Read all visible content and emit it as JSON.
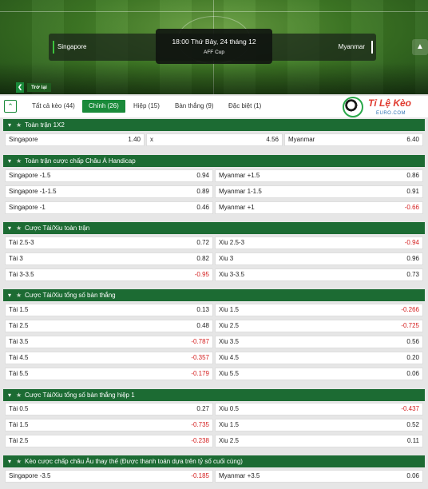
{
  "match": {
    "home": "Singapore",
    "away": "Myanmar",
    "time": "18:00 Thứ Bảy, 24 tháng 12",
    "league": "AFF Cup",
    "back_label": "Trở lại"
  },
  "tabs": [
    {
      "label": "Tất cả kèo (44)",
      "active": false
    },
    {
      "label": "Chính (26)",
      "active": true
    },
    {
      "label": "Hiệp (15)",
      "active": false
    },
    {
      "label": "Bàn thắng (9)",
      "active": false
    },
    {
      "label": "Đặc biệt (1)",
      "active": false
    }
  ],
  "logo": {
    "brand": "Tỉ Lệ Kèo",
    "sub": "EURO.COM"
  },
  "colors": {
    "accent": "#1a8a3a",
    "section": "#1c6b33",
    "negative": "#d42020"
  },
  "sections": {
    "s1": {
      "title": "Toàn trận 1X2",
      "cells": [
        {
          "label": "Singapore",
          "value": "1.40"
        },
        {
          "label": "x",
          "value": "4.56"
        },
        {
          "label": "Myanmar",
          "value": "6.40"
        }
      ]
    },
    "s2": {
      "title": "Toàn trận cược chấp Châu Á Handicap",
      "rows": [
        [
          {
            "label": "Singapore -1.5",
            "value": "0.94"
          },
          {
            "label": "Myanmar +1.5",
            "value": "0.86"
          }
        ],
        [
          {
            "label": "Singapore -1-1.5",
            "value": "0.89"
          },
          {
            "label": "Myanmar 1-1.5",
            "value": "0.91"
          }
        ],
        [
          {
            "label": "Singapore -1",
            "value": "0.46"
          },
          {
            "label": "Myanmar +1",
            "value": "-0.66"
          }
        ]
      ]
    },
    "s3": {
      "title": "Cược Tài/Xiu toàn trận",
      "rows": [
        [
          {
            "label": "Tài 2.5-3",
            "value": "0.72"
          },
          {
            "label": "Xiu 2.5-3",
            "value": "-0.94"
          }
        ],
        [
          {
            "label": "Tài 3",
            "value": "0.82"
          },
          {
            "label": "Xiu 3",
            "value": "0.96"
          }
        ],
        [
          {
            "label": "Tài 3-3.5",
            "value": "-0.95"
          },
          {
            "label": "Xiu 3-3.5",
            "value": "0.73"
          }
        ]
      ]
    },
    "s4": {
      "title": "Cược Tài/Xiu tổng số bàn thắng",
      "rows": [
        [
          {
            "label": "Tài 1.5",
            "value": "0.13"
          },
          {
            "label": "Xiu 1.5",
            "value": "-0.266"
          }
        ],
        [
          {
            "label": "Tài 2.5",
            "value": "0.48"
          },
          {
            "label": "Xiu 2.5",
            "value": "-0.725"
          }
        ],
        [
          {
            "label": "Tài 3.5",
            "value": "-0.787"
          },
          {
            "label": "Xiu 3.5",
            "value": "0.56"
          }
        ],
        [
          {
            "label": "Tài 4.5",
            "value": "-0.357"
          },
          {
            "label": "Xiu 4.5",
            "value": "0.20"
          }
        ],
        [
          {
            "label": "Tài 5.5",
            "value": "-0.179"
          },
          {
            "label": "Xiu 5.5",
            "value": "0.06"
          }
        ]
      ]
    },
    "s5": {
      "title": "Cược Tài/Xiu tổng số bàn thắng hiệp 1",
      "rows": [
        [
          {
            "label": "Tài 0.5",
            "value": "0.27"
          },
          {
            "label": "Xiu 0.5",
            "value": "-0.437"
          }
        ],
        [
          {
            "label": "Tài 1.5",
            "value": "-0.735"
          },
          {
            "label": "Xiu 1.5",
            "value": "0.52"
          }
        ],
        [
          {
            "label": "Tài 2.5",
            "value": "-0.238"
          },
          {
            "label": "Xiu 2.5",
            "value": "0.11"
          }
        ]
      ]
    },
    "s6": {
      "title": "Kèo cược chấp châu Âu thay thế (Được thanh toán dựa trên tỷ số cuối cùng)",
      "rows": [
        [
          {
            "label": "Singapore -3.5",
            "value": "-0.185"
          },
          {
            "label": "Myanmar +3.5",
            "value": "0.06"
          }
        ]
      ]
    }
  }
}
